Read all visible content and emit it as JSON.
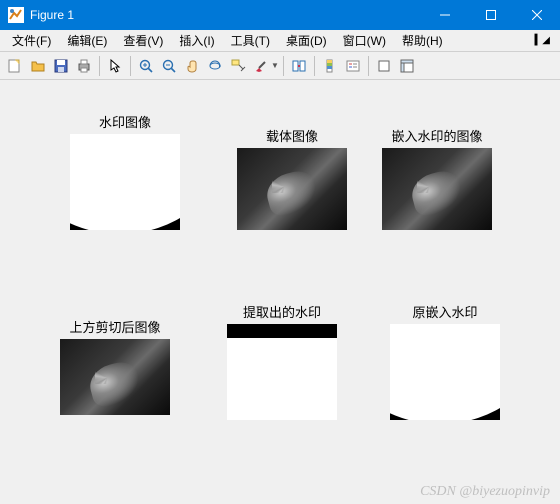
{
  "window": {
    "title": "Figure 1"
  },
  "menu": {
    "file": "文件(F)",
    "edit": "编辑(E)",
    "view": "查看(V)",
    "insert": "插入(I)",
    "tools": "工具(T)",
    "desktop": "桌面(D)",
    "window": "窗口(W)",
    "help": "帮助(H)"
  },
  "subplots": {
    "watermark_image": "水印图像",
    "carrier_image": "载体图像",
    "embedded_image": "嵌入水印的图像",
    "cropped_image": "上方剪切后图像",
    "extracted_watermark": "提取出的水印",
    "original_embedded_mark": "原嵌入水印"
  },
  "footer": "CSDN @biyezuopinvip"
}
